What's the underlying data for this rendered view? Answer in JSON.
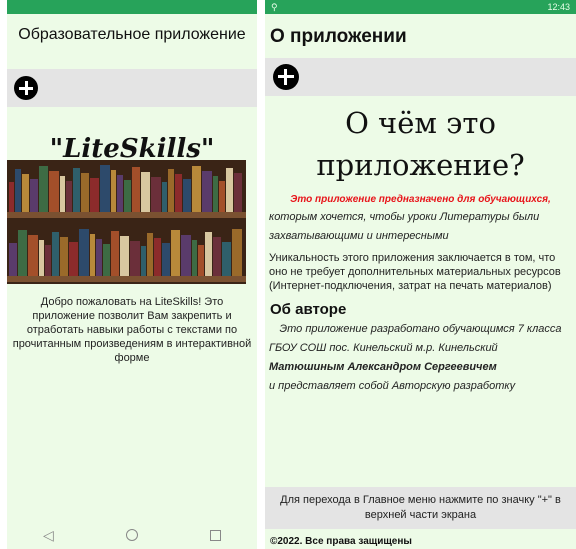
{
  "left_screen": {
    "title": "Образовательное приложение",
    "app_name": "\"LiteSkills\"",
    "welcome_text": "Добро пожаловать на LiteSkills! Это приложение позволит Вам закрепить и отработать навыки работы с текстами по прочитанным произведениям в интерактивной форме",
    "nav": {
      "back": "◁",
      "home": "○"
    }
  },
  "right_screen": {
    "status_time": "12:43",
    "title": "О приложении",
    "heading": "О чём это приложение?",
    "highlight": "Это приложение предназначено для обучающихся,",
    "line1": "которым хочется, чтобы уроки Литературы были",
    "line2": "захватывающими и интересными",
    "uniqueness": "Уникальность этого приложения заключается в том, что оно не требует дополнительных материальных ресурсов (Интернет-подключения, затрат на печать материалов)",
    "author_heading": "Об авторе",
    "author_line1": "Это приложение разработано обучающимся 7 класса",
    "author_line2": "ГБОУ СОШ пос. Кинельский м.р. Кинельский",
    "author_name": "Матюшиным Александром Сергеевичем",
    "author_line3": "и представляет собой Авторскую разработку",
    "footer_hint": "Для перехода в Главное меню нажмите по значку \"+\" в верхней части экрана",
    "copyright": "©2022. Все права защищены"
  },
  "colors": {
    "background": "#edfbe7",
    "status_bar": "#27a35a",
    "accent_red": "#e8141a",
    "bar_gray": "#e4e4e4"
  }
}
